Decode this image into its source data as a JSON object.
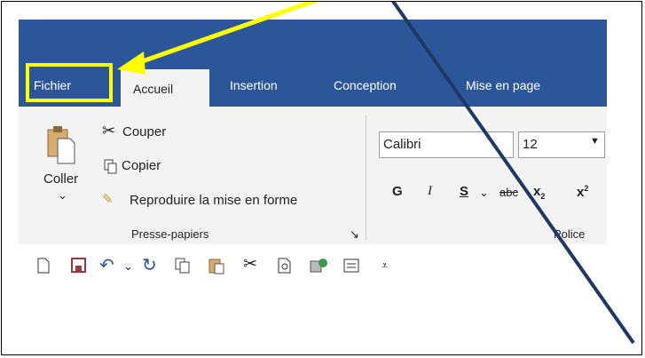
{
  "tabs": [
    "Fichier",
    "Accueil",
    "Insertion",
    "Conception",
    "Mise en page"
  ],
  "clipboard": {
    "paste": "Coller",
    "cut": "Couper",
    "copy": "Copier",
    "format_painter": "Reproduire la mise en forme",
    "group_label": "Presse-papiers"
  },
  "font": {
    "name": "Calibri",
    "size": "12",
    "bold": "G",
    "italic": "I",
    "underline": "S",
    "strike": "abc",
    "subscript": "x",
    "superscript": "x",
    "group_label": "Police"
  },
  "colors": {
    "ribbon": "#2b579a",
    "highlight": "#ffff00",
    "arrow_line": "#1f3864"
  },
  "quick_access_icons": [
    "new-document-icon",
    "save-icon",
    "undo-icon",
    "redo-icon",
    "copy-icon",
    "paste-icon",
    "cut-icon",
    "print-preview-icon",
    "spelling-icon",
    "form-icon",
    "customize-qat-icon"
  ]
}
